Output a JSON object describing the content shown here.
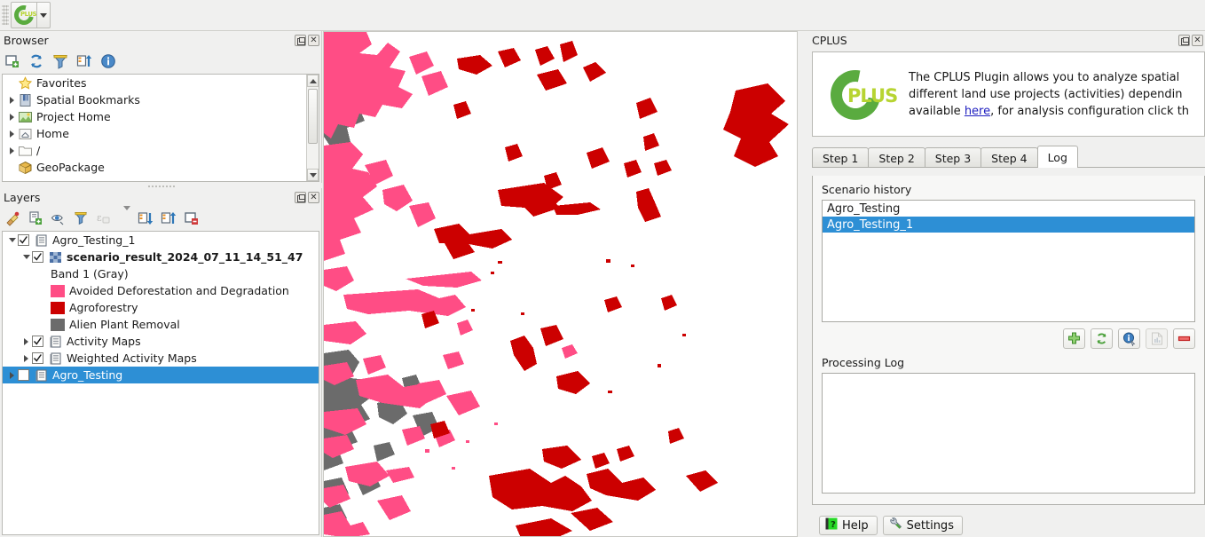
{
  "toolbar": {
    "plugin_button_label": "CPLUS",
    "dropdown_label": "Open plugin menu"
  },
  "browser": {
    "title": "Browser",
    "toolbar": [
      {
        "name": "add-layer-icon",
        "label": "Add Selected Layers"
      },
      {
        "name": "refresh-icon",
        "label": "Refresh"
      },
      {
        "name": "filter-icon",
        "label": "Filter Browser"
      },
      {
        "name": "collapse-all-icon",
        "label": "Collapse All"
      },
      {
        "name": "properties-info-icon",
        "label": "Properties"
      }
    ],
    "items": [
      {
        "label": "Favorites",
        "icon": "star-icon",
        "expandable": false
      },
      {
        "label": "Spatial Bookmarks",
        "icon": "bookmark-icon",
        "expandable": true
      },
      {
        "label": "Project Home",
        "icon": "project-home-icon",
        "expandable": true
      },
      {
        "label": "Home",
        "icon": "home-icon",
        "expandable": true
      },
      {
        "label": "/",
        "icon": "folder-icon",
        "expandable": true
      },
      {
        "label": "GeoPackage",
        "icon": "geopackage-icon",
        "expandable": false
      }
    ]
  },
  "layers": {
    "title": "Layers",
    "toolbar": [
      {
        "name": "open-layer-styling-icon",
        "label": "Open Layer Styling Panel"
      },
      {
        "name": "add-group-icon",
        "label": "Add Group"
      },
      {
        "name": "manage-visibility-icon",
        "label": "Manage Map Themes"
      },
      {
        "name": "filter-legend-icon",
        "label": "Filter Legend"
      },
      {
        "name": "expression-filter-icon",
        "label": "Filter Legend By Expression"
      },
      {
        "name": "expand-all-icon",
        "label": "Expand All"
      },
      {
        "name": "collapse-all-icon",
        "label": "Collapse All"
      },
      {
        "name": "remove-layer-icon",
        "label": "Remove Layer/Group"
      }
    ],
    "tree": [
      {
        "label": "Agro_Testing_1",
        "type": "group",
        "indent": 0,
        "expanded": true,
        "checked": true,
        "icon": "group-icon",
        "bold": false
      },
      {
        "label": "scenario_result_2024_07_11_14_51_47",
        "type": "raster",
        "indent": 1,
        "expanded": true,
        "checked": true,
        "icon": "raster-icon",
        "bold": true
      },
      {
        "label": "Band 1 (Gray)",
        "type": "band",
        "indent": 2,
        "icon": "none",
        "bold": false
      },
      {
        "label": "Avoided Deforestation and Degradation",
        "type": "legend",
        "indent": 2,
        "swatch": "#ff4d85",
        "bold": false
      },
      {
        "label": "Agroforestry",
        "type": "legend",
        "indent": 2,
        "swatch": "#cc0000",
        "bold": false
      },
      {
        "label": "Alien Plant Removal",
        "type": "legend",
        "indent": 2,
        "swatch": "#6b6b6b",
        "bold": false
      },
      {
        "label": "Activity Maps",
        "type": "group",
        "indent": 1,
        "expanded": false,
        "checked": true,
        "icon": "group-icon",
        "bold": false
      },
      {
        "label": "Weighted Activity Maps",
        "type": "group",
        "indent": 1,
        "expanded": false,
        "checked": true,
        "icon": "group-icon",
        "bold": false
      },
      {
        "label": "Agro_Testing",
        "type": "group",
        "indent": 0,
        "expanded": false,
        "checked": false,
        "icon": "group-icon",
        "selected": true,
        "bold": false
      }
    ]
  },
  "map": {
    "name": "map-canvas",
    "background": "#ffffff",
    "legend_colors": {
      "avoided_deforestation": "#ff4d85",
      "agroforestry": "#cc0000",
      "alien_plant_removal": "#6b6b6b"
    }
  },
  "cplus": {
    "title": "CPLUS",
    "logo_text": "PLUS",
    "description_lines": [
      "The CPLUS Plugin allows you to analyze spatial ",
      "different land use projects (activities) dependin",
      "available "
    ],
    "link_text": "here",
    "description_tail": ", for analysis configuration click th",
    "tabs": [
      {
        "label": "Step 1",
        "active": false
      },
      {
        "label": "Step 2",
        "active": false
      },
      {
        "label": "Step 3",
        "active": false
      },
      {
        "label": "Step 4",
        "active": false
      },
      {
        "label": "Log",
        "active": true
      }
    ],
    "scenario_history_label": "Scenario history",
    "scenarios": [
      {
        "label": "Agro_Testing",
        "selected": false
      },
      {
        "label": "Agro_Testing_1",
        "selected": true
      }
    ],
    "list_actions": [
      {
        "name": "add-scenario-button",
        "label": "Add",
        "enabled": true
      },
      {
        "name": "update-scenario-button",
        "label": "Update",
        "enabled": true
      },
      {
        "name": "scenario-info-button",
        "label": "Info",
        "enabled": true
      },
      {
        "name": "generate-report-button",
        "label": "Report",
        "enabled": false
      },
      {
        "name": "remove-scenario-button",
        "label": "Remove",
        "enabled": true
      }
    ],
    "processing_log_label": "Processing Log",
    "processing_log_text": "",
    "help_button": "Help",
    "settings_button": "Settings"
  }
}
